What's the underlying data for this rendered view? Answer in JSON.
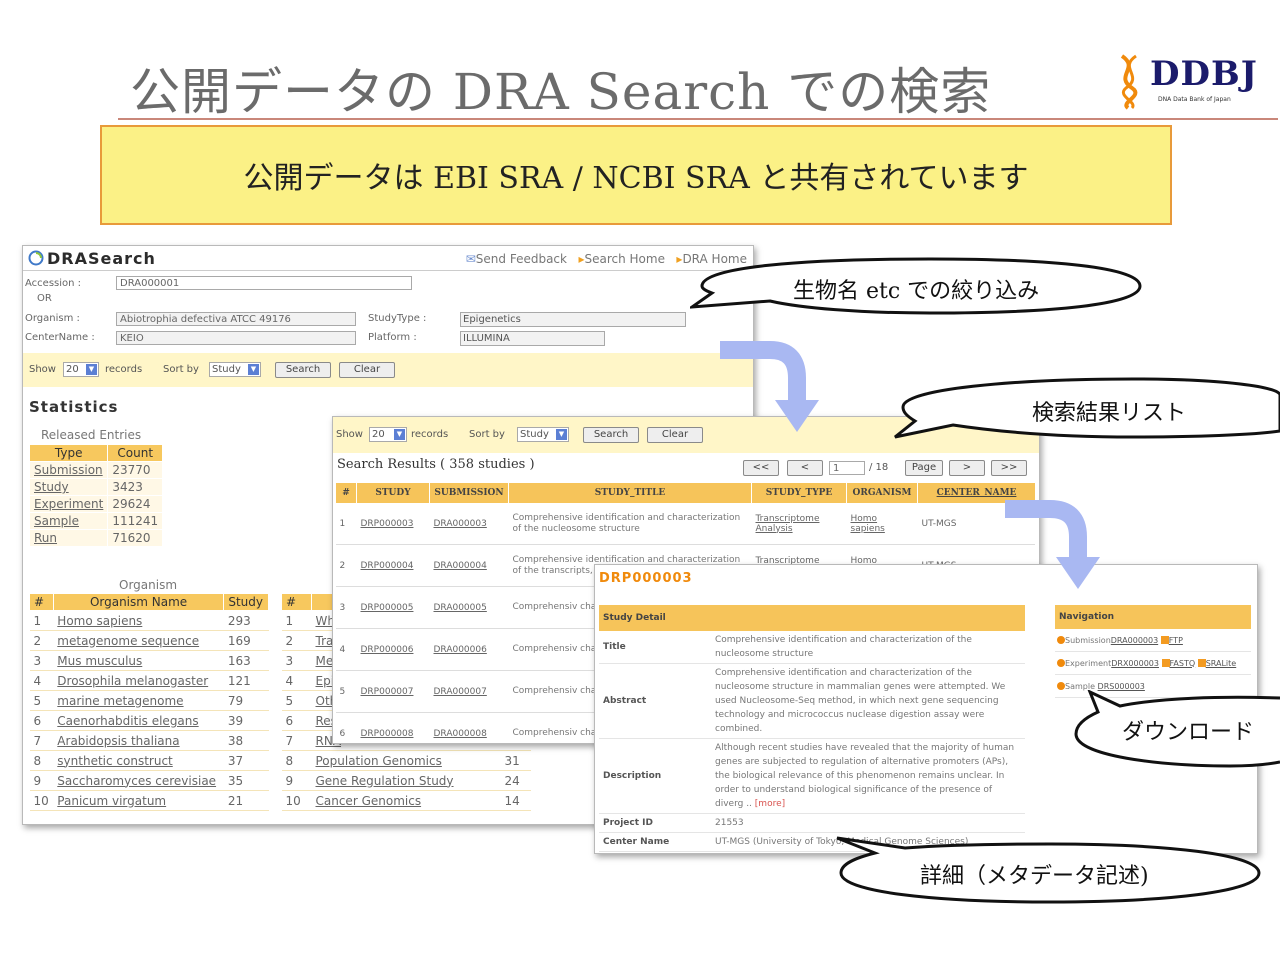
{
  "slide": {
    "title": "公開データの DRA Search での検索",
    "banner": "公開データは EBI SRA / NCBI SRA と共有されています",
    "logo": {
      "name": "DDBJ",
      "subtitle": "DNA Data Bank of Japan"
    }
  },
  "callouts": {
    "filter": "生物名 etc での絞り込み",
    "results": "検索結果リスト",
    "download": "ダウンロード",
    "detail": "詳細（メタデータ記述)"
  },
  "main_window": {
    "app_title": "DRASearch",
    "links": {
      "feedback": "Send Feedback",
      "search_home": "Search Home",
      "dra_home": "DRA Home"
    },
    "form": {
      "accession_label": "Accession :",
      "or_label": "OR",
      "accession_value": "DRA000001",
      "organism_label": "Organism :",
      "organism_value": "Abiotrophia defectiva ATCC 49176",
      "centername_label": "CenterName :",
      "centername_value": "KEIO",
      "studytype_label": "StudyType :",
      "studytype_value": "Epigenetics",
      "platform_label": "Platform :",
      "platform_value": "ILLUMINA"
    },
    "controls": {
      "show_label": "Show",
      "show_value": "20",
      "records_label": "records",
      "sortby_label": "Sort by",
      "sortby_value": "Study",
      "search_btn": "Search",
      "clear_btn": "Clear"
    },
    "statistics": {
      "title": "Statistics",
      "released_label": "Released Entries",
      "headers": [
        "Type",
        "Count"
      ],
      "rows": [
        {
          "type": "Submission",
          "count": "23770"
        },
        {
          "type": "Study",
          "count": "3423"
        },
        {
          "type": "Experiment",
          "count": "29624"
        },
        {
          "type": "Sample",
          "count": "111241"
        },
        {
          "type": "Run",
          "count": "71620"
        }
      ],
      "organism_label": "Organism",
      "organism_headers": [
        "#",
        "Organism Name",
        "Study"
      ],
      "organisms": [
        {
          "n": "1",
          "name": "Homo sapiens",
          "study": "293"
        },
        {
          "n": "2",
          "name": "metagenome sequence",
          "study": "169"
        },
        {
          "n": "3",
          "name": "Mus musculus",
          "study": "163"
        },
        {
          "n": "4",
          "name": "Drosophila melanogaster",
          "study": "121"
        },
        {
          "n": "5",
          "name": "marine metagenome",
          "study": "79"
        },
        {
          "n": "6",
          "name": "Caenorhabditis elegans",
          "study": "39"
        },
        {
          "n": "7",
          "name": "Arabidopsis thaliana",
          "study": "38"
        },
        {
          "n": "8",
          "name": "synthetic construct",
          "study": "37"
        },
        {
          "n": "9",
          "name": "Saccharomyces cerevisiae",
          "study": "35"
        },
        {
          "n": "10",
          "name": "Panicum virgatum",
          "study": "21"
        }
      ],
      "study_headers": [
        "#",
        "",
        ""
      ],
      "studies": [
        {
          "n": "1",
          "name": "Whe",
          "count": ""
        },
        {
          "n": "2",
          "name": "Tran",
          "count": ""
        },
        {
          "n": "3",
          "name": "Met",
          "count": ""
        },
        {
          "n": "4",
          "name": "Epig",
          "count": ""
        },
        {
          "n": "5",
          "name": "Oth",
          "count": ""
        },
        {
          "n": "6",
          "name": "Res",
          "count": ""
        },
        {
          "n": "7",
          "name": "RNA",
          "count": ""
        },
        {
          "n": "8",
          "name": "Population Genomics",
          "count": "31"
        },
        {
          "n": "9",
          "name": "Gene Regulation Study",
          "count": "24"
        },
        {
          "n": "10",
          "name": "Cancer Genomics",
          "count": "14"
        }
      ]
    }
  },
  "results_window": {
    "controls": {
      "show_label": "Show",
      "show_value": "20",
      "records_label": "records",
      "sortby_label": "Sort by",
      "sortby_value": "Study",
      "search_btn": "Search",
      "clear_btn": "Clear"
    },
    "title": "Search Results ( 358 studies )",
    "pager": {
      "first": "<<",
      "prev": "<",
      "page": "1",
      "total": "/ 18",
      "page_btn": "Page",
      "next": ">",
      "last": ">>"
    },
    "headers": [
      "#",
      "STUDY",
      "SUBMISSION",
      "STUDY_TITLE",
      "STUDY_TYPE",
      "ORGANISM",
      "CENTER_NAME"
    ],
    "rows": [
      {
        "n": "1",
        "study": "DRP000003",
        "submission": "DRA000003",
        "title": "Comprehensive identification and characterization of the nucleosome structure",
        "type": "Transcriptome Analysis",
        "organism": "Homo sapiens",
        "center": "UT-MGS"
      },
      {
        "n": "2",
        "study": "DRP000004",
        "submission": "DRA000004",
        "title": "Comprehensive identification and characterization of the transcripts, their expression lev",
        "type": "Transcriptome Analysis",
        "organism": "Homo sapiens",
        "center": "UT-MGS"
      },
      {
        "n": "3",
        "study": "DRP000005",
        "submission": "DRA000005",
        "title": "Comprehensiv characterizati expression lev",
        "type": "",
        "organism": "",
        "center": ""
      },
      {
        "n": "4",
        "study": "DRP000006",
        "submission": "DRA000006",
        "title": "Comprehensiv characterizati expression lev",
        "type": "",
        "organism": "",
        "center": ""
      },
      {
        "n": "5",
        "study": "DRP000007",
        "submission": "DRA000007",
        "title": "Comprehensiv characterizati polymerase II",
        "type": "",
        "organism": "",
        "center": ""
      },
      {
        "n": "6",
        "study": "DRP000008",
        "submission": "DRA000008",
        "title": "Comprehensiv characterizati",
        "type": "",
        "organism": "",
        "center": ""
      }
    ]
  },
  "detail_window": {
    "title": "DRP000003",
    "section": "Study Detail",
    "fields": [
      {
        "key": "Title",
        "value": "Comprehensive identification and characterization of the nucleosome structure"
      },
      {
        "key": "Abstract",
        "value": "Comprehensive identification and characterization of the nucleosome structure in mammalian genes were attempted. We used Nucleosome-Seq method, in which next gene sequencing technology and micrococcus nuclease digestion assay were combined."
      },
      {
        "key": "Description",
        "value": "Although recent studies have revealed that the majority of human genes are subjected to regulation of alternative promoters (APs), the biological relevance of this phenomenon remains unclear. In order to understand biological significance of the presence of diverg ..",
        "more": "[more]"
      },
      {
        "key": "Project ID",
        "value": "21553"
      },
      {
        "key": "Center Name",
        "value": "UT-MGS (University of Tokyo, Medical Genome Sciences)"
      }
    ],
    "navigation": {
      "title": "Navigation",
      "submission_label": "Submission",
      "submission_value": "DRA000003",
      "ftp": "FTP",
      "experiment_label": "Experiment",
      "experiment_value": "DRX000003",
      "fastq": "FASTQ",
      "sralite": "SRALite",
      "sample_label": "Sample",
      "sample_value": "DRS000003"
    }
  },
  "colors": {
    "banner_bg": "#fbf186",
    "banner_border": "#e89a3a",
    "table_header": "#f6c45a",
    "accent_orange": "#f08a0c",
    "arrow": "#a9b8f2"
  }
}
